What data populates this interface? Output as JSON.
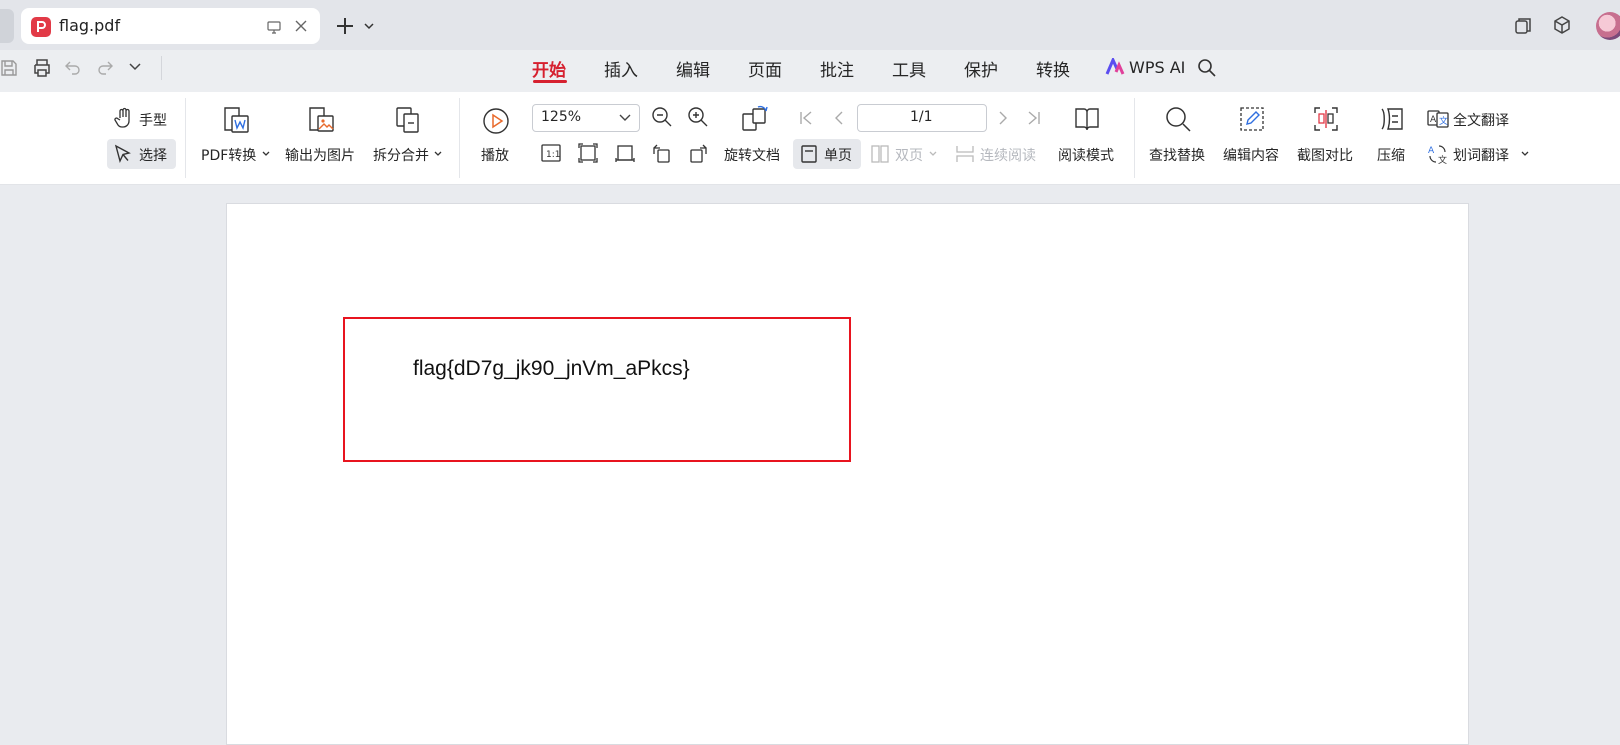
{
  "tab": {
    "title": "flag.pdf"
  },
  "menu": {
    "items": [
      "开始",
      "插入",
      "编辑",
      "页面",
      "批注",
      "工具",
      "保护",
      "转换"
    ],
    "ai_label": "WPS AI",
    "active_color": "#d6202f"
  },
  "ribbon": {
    "hand_tool": "手型",
    "select_tool": "选择",
    "pdf_convert": "PDF转换",
    "export_image": "输出为图片",
    "split_merge": "拆分合并",
    "play": "播放",
    "zoom_value": "125%",
    "page_value": "1/1",
    "rotate_doc": "旋转文档",
    "single_page": "单页",
    "double_page": "双页",
    "continuous_read": "连续阅读",
    "read_mode": "阅读模式",
    "find_replace": "查找替换",
    "edit_content": "编辑内容",
    "screenshot_compare": "截图对比",
    "compress": "压缩",
    "full_translate": "全文翻译",
    "word_translate": "划词翻译"
  },
  "document": {
    "flag_text": "flag{dD7g_jk90_jnVm_aPkcs}",
    "box_color": "#e8141f"
  },
  "icons": [
    "pdf-logo-icon",
    "screen-icon",
    "close-icon",
    "plus-icon",
    "chevron-down-icon",
    "restore-window-icon",
    "cube-icon",
    "save-icon",
    "print-icon",
    "undo-icon",
    "redo-icon",
    "search-icon",
    "hand-icon",
    "cursor-icon",
    "play-icon",
    "zoom-out-icon",
    "zoom-in-icon",
    "first-page-icon",
    "prev-page-icon",
    "next-page-icon",
    "last-page-icon",
    "book-icon"
  ]
}
